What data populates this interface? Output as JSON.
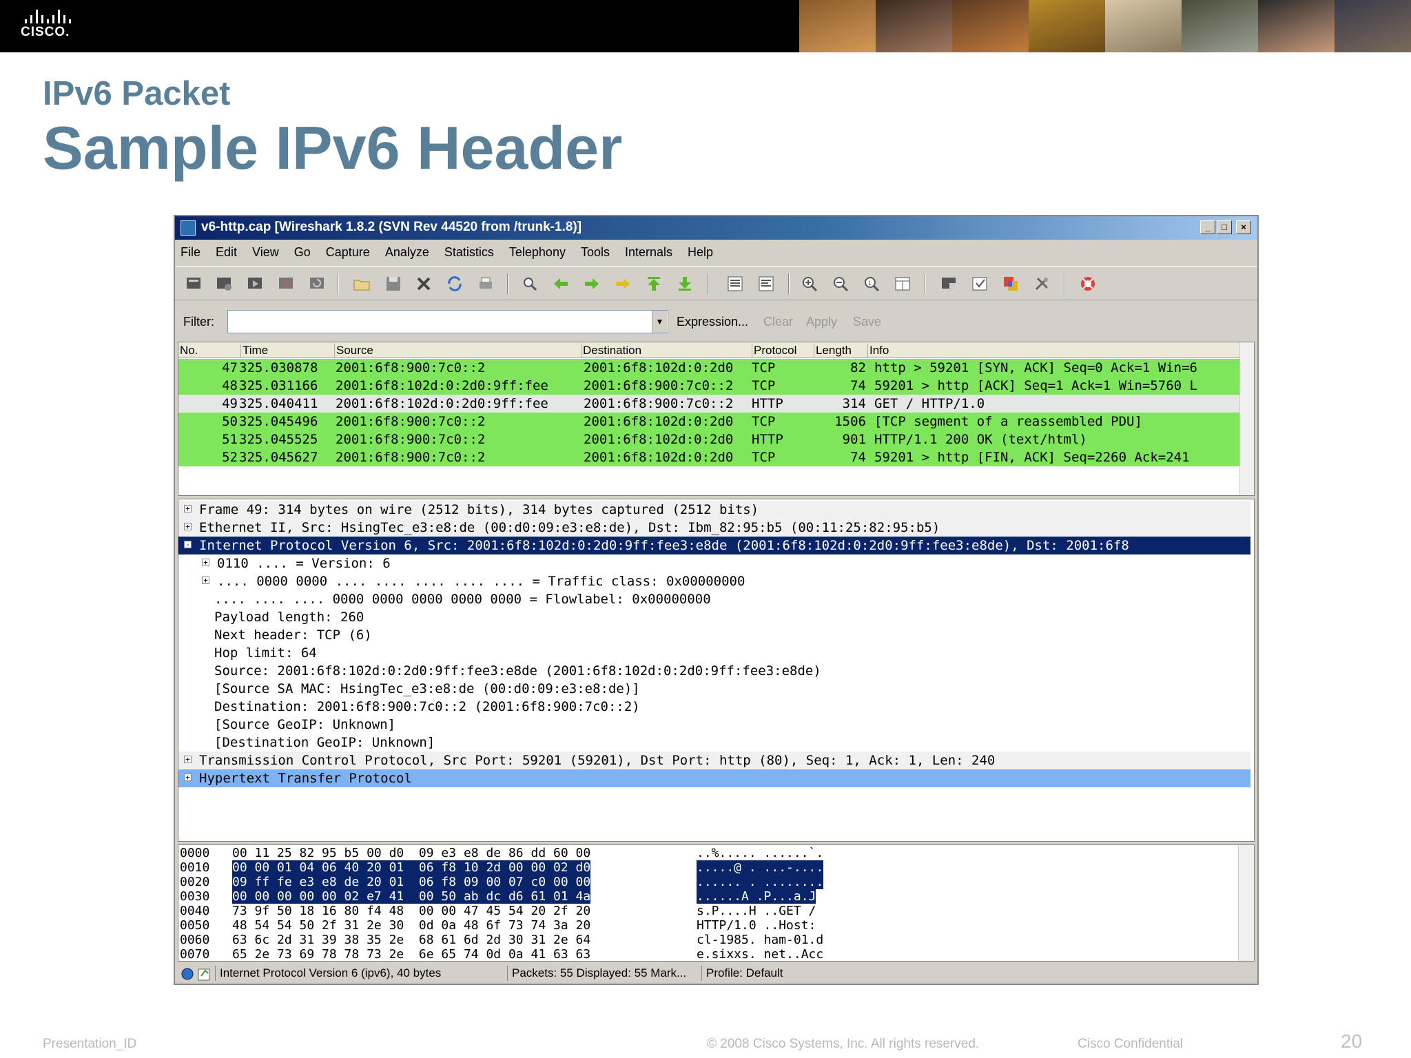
{
  "banner": {
    "logo_text": "CISCO."
  },
  "slide": {
    "subtitle": "IPv6 Packet",
    "title": "Sample IPv6 Header",
    "footer_left": "Presentation_ID",
    "footer_center": "© 2008 Cisco Systems, Inc. All rights reserved.",
    "footer_right": "Cisco Confidential",
    "page_number": "20"
  },
  "window": {
    "title": "v6-http.cap  [Wireshark 1.8.2  (SVN Rev 44520 from /trunk-1.8)]",
    "min_glyph": "_",
    "max_glyph": "□",
    "close_glyph": "×"
  },
  "menu": [
    "File",
    "Edit",
    "View",
    "Go",
    "Capture",
    "Analyze",
    "Statistics",
    "Telephony",
    "Tools",
    "Internals",
    "Help"
  ],
  "filter": {
    "label": "Filter:",
    "value": "",
    "expression": "Expression...",
    "clear": "Clear",
    "apply": "Apply",
    "save": "Save"
  },
  "packet_list": {
    "columns": [
      "No.",
      "Time",
      "Source",
      "Destination",
      "Protocol",
      "Length",
      "Info"
    ],
    "rows": [
      {
        "no": "47",
        "time": "325.030878",
        "src": "2001:6f8:900:7c0::2",
        "dst": "2001:6f8:102d:0:2d0",
        "proto": "TCP",
        "len": "82",
        "info": "http > 59201 [SYN, ACK] Seq=0 Ack=1 Win=6"
      },
      {
        "no": "48",
        "time": "325.031166",
        "src": "2001:6f8:102d:0:2d0:9ff:fee",
        "dst": "2001:6f8:900:7c0::2",
        "proto": "TCP",
        "len": "74",
        "info": "59201 > http [ACK] Seq=1 Ack=1 Win=5760 L"
      },
      {
        "no": "49",
        "time": "325.040411",
        "src": "2001:6f8:102d:0:2d0:9ff:fee",
        "dst": "2001:6f8:900:7c0::2",
        "proto": "HTTP",
        "len": "314",
        "info": "GET / HTTP/1.0"
      },
      {
        "no": "50",
        "time": "325.045496",
        "src": "2001:6f8:900:7c0::2",
        "dst": "2001:6f8:102d:0:2d0",
        "proto": "TCP",
        "len": "1506",
        "info": "[TCP segment of a reassembled PDU]"
      },
      {
        "no": "51",
        "time": "325.045525",
        "src": "2001:6f8:900:7c0::2",
        "dst": "2001:6f8:102d:0:2d0",
        "proto": "HTTP",
        "len": "901",
        "info": "HTTP/1.1 200 OK  (text/html)"
      },
      {
        "no": "52",
        "time": "325.045627",
        "src": "2001:6f8:900:7c0::2",
        "dst": "2001:6f8:102d:0:2d0",
        "proto": "TCP",
        "len": "74",
        "info": "59201 > http [FIN, ACK] Seq=2260 Ack=241"
      }
    ],
    "row_colors": [
      "#7ee65a",
      "#7ee65a",
      "#e6e6e6",
      "#7ee65a",
      "#7ee65a",
      "#7ee65a"
    ]
  },
  "details": [
    {
      "indent": 0,
      "toggle": "+",
      "text": "Frame 49: 314 bytes on wire (2512 bits), 314 bytes captured (2512 bits)",
      "style": "plain"
    },
    {
      "indent": 0,
      "toggle": "+",
      "text": "Ethernet II, Src: HsingTec_e3:e8:de (00:d0:09:e3:e8:de), Dst: Ibm_82:95:b5 (00:11:25:82:95:b5)",
      "style": "plain"
    },
    {
      "indent": 0,
      "toggle": "-",
      "text": "Internet Protocol Version 6, Src: 2001:6f8:102d:0:2d0:9ff:fee3:e8de (2001:6f8:102d:0:2d0:9ff:fee3:e8de), Dst: 2001:6f8",
      "style": "selected"
    },
    {
      "indent": 1,
      "toggle": "+",
      "text": "0110 .... = Version: 6",
      "style": "white"
    },
    {
      "indent": 1,
      "toggle": "+",
      "text": ".... 0000 0000 .... .... .... .... .... = Traffic class: 0x00000000",
      "style": "white"
    },
    {
      "indent": 2,
      "toggle": "",
      "text": ".... .... .... 0000 0000 0000 0000 0000 = Flowlabel: 0x00000000",
      "style": "white"
    },
    {
      "indent": 2,
      "toggle": "",
      "text": "Payload length: 260",
      "style": "white"
    },
    {
      "indent": 2,
      "toggle": "",
      "text": "Next header: TCP (6)",
      "style": "white"
    },
    {
      "indent": 2,
      "toggle": "",
      "text": "Hop limit: 64",
      "style": "white"
    },
    {
      "indent": 2,
      "toggle": "",
      "text": "Source: 2001:6f8:102d:0:2d0:9ff:fee3:e8de (2001:6f8:102d:0:2d0:9ff:fee3:e8de)",
      "style": "white"
    },
    {
      "indent": 2,
      "toggle": "",
      "text": "[Source SA MAC: HsingTec_e3:e8:de (00:d0:09:e3:e8:de)]",
      "style": "white"
    },
    {
      "indent": 2,
      "toggle": "",
      "text": "Destination: 2001:6f8:900:7c0::2 (2001:6f8:900:7c0::2)",
      "style": "white"
    },
    {
      "indent": 2,
      "toggle": "",
      "text": "[Source GeoIP: Unknown]",
      "style": "white"
    },
    {
      "indent": 2,
      "toggle": "",
      "text": "[Destination GeoIP: Unknown]",
      "style": "white"
    },
    {
      "indent": 0,
      "toggle": "+",
      "text": "Transmission Control Protocol, Src Port: 59201 (59201), Dst Port: http (80), Seq: 1, Ack: 1, Len: 240",
      "style": "plain"
    },
    {
      "indent": 0,
      "toggle": "+",
      "text": "Hypertext Transfer Protocol",
      "style": "http"
    }
  ],
  "hex": [
    {
      "off": "0000",
      "bytes": "00 11 25 82 95 b5 00 d0  09 e3 e8 de 86 dd 60 00",
      "ascii": "..%..... ......`."
    },
    {
      "off": "0010",
      "bytes": "00 00 01 04 06 40 20 01  06 f8 10 2d 00 00 02 d0",
      "ascii": ".....@ . ...-...."
    },
    {
      "off": "0020",
      "bytes": "09 ff fe e3 e8 de 20 01  06 f8 09 00 07 c0 00 00",
      "ascii": "...... . ........"
    },
    {
      "off": "0030",
      "bytes": "00 00 00 00 00 02 e7 41  00 50 ab dc d6 61 01 4a",
      "ascii": "......A .P...a.J"
    },
    {
      "off": "0040",
      "bytes": "73 9f 50 18 16 80 f4 48  00 00 47 45 54 20 2f 20",
      "ascii": "s.P....H ..GET / "
    },
    {
      "off": "0050",
      "bytes": "48 54 54 50 2f 31 2e 30  0d 0a 48 6f 73 74 3a 20",
      "ascii": "HTTP/1.0 ..Host: "
    },
    {
      "off": "0060",
      "bytes": "63 6c 2d 31 39 38 35 2e  68 61 6d 2d 30 31 2e 64",
      "ascii": "cl-1985. ham-01.d"
    },
    {
      "off": "0070",
      "bytes": "65 2e 73 69 78 78 73 2e  6e 65 74 0d 0a 41 63 63",
      "ascii": "e.sixxs. net..Acc"
    }
  ],
  "status": {
    "field": "Internet Protocol Version 6 (ipv6), 40 bytes",
    "packets": "Packets: 55 Displayed: 55 Mark...",
    "profile": "Profile: Default"
  },
  "colors": {
    "selected": "#0a246a",
    "http_highlight": "#7fb2f0",
    "tcp_green": "#7ee65a",
    "title_blue": "#5a7f98"
  }
}
